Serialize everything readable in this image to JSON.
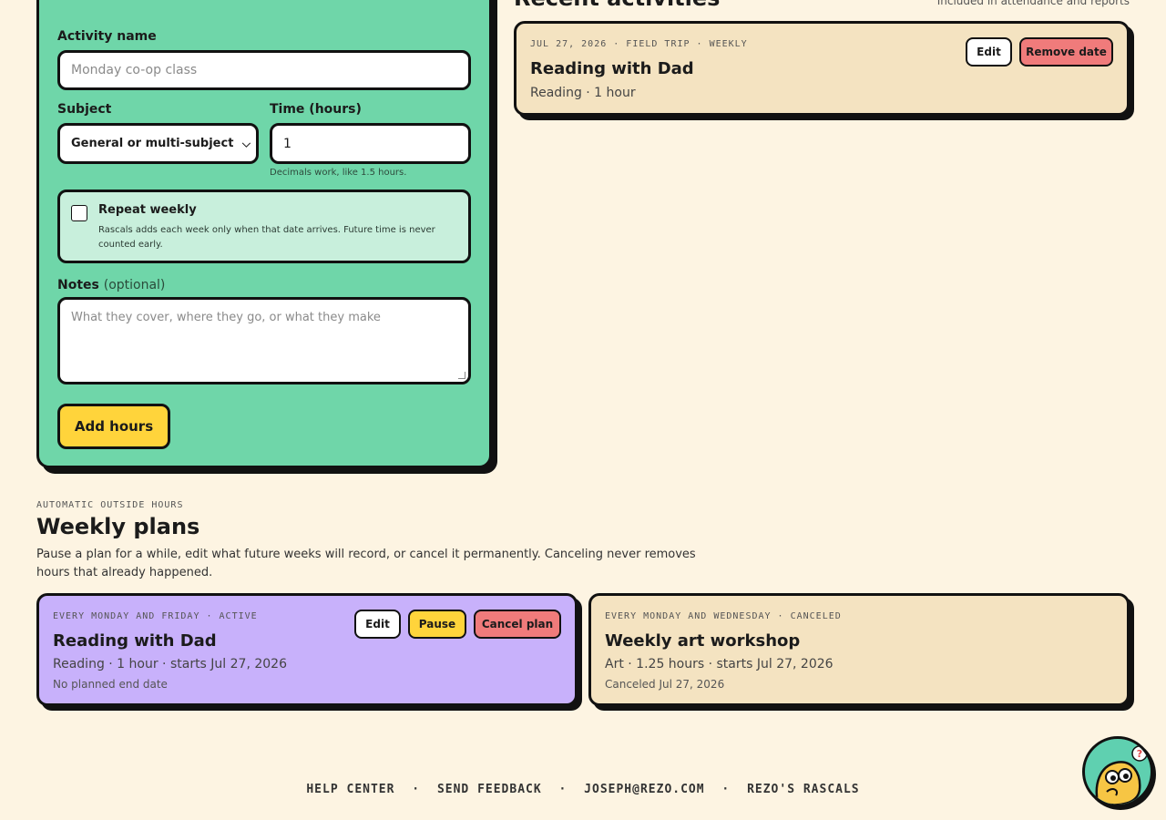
{
  "form": {
    "activity_name_label": "Activity name",
    "activity_name_placeholder": "Monday co-op class",
    "subject_label": "Subject",
    "subject_value": "General or multi-subject",
    "time_label": "Time (hours)",
    "time_value": "1",
    "time_hint": "Decimals work, like 1.5 hours.",
    "repeat_title": "Repeat weekly",
    "repeat_desc": "Rascals adds each week only when that date arrives. Future time is never counted early.",
    "notes_label": "Notes",
    "notes_optional": "(optional)",
    "notes_placeholder": "What they cover, where they go, or what they make",
    "submit_label": "Add hours"
  },
  "recent": {
    "title": "Recent activities",
    "note": "Included in attendance and reports",
    "items": [
      {
        "meta": "JUL 27, 2026 · FIELD TRIP · WEEKLY",
        "title": "Reading with Dad",
        "subtitle": "Reading · 1 hour",
        "edit_label": "Edit",
        "remove_label": "Remove date"
      }
    ]
  },
  "weekly": {
    "kicker": "AUTOMATIC OUTSIDE HOURS",
    "title": "Weekly plans",
    "description": "Pause a plan for a while, edit what future weeks will record, or cancel it permanently. Canceling never removes hours that already happened.",
    "plans": [
      {
        "meta": "EVERY MONDAY AND FRIDAY · ACTIVE",
        "title": "Reading with Dad",
        "subtitle": "Reading · 1 hour · starts Jul 27, 2026",
        "detail": "No planned end date",
        "edit_label": "Edit",
        "pause_label": "Pause",
        "cancel_label": "Cancel plan"
      },
      {
        "meta": "EVERY MONDAY AND WEDNESDAY · CANCELED",
        "title": "Weekly art workshop",
        "subtitle": "Art · 1.25 hours · starts Jul 27, 2026",
        "detail": "Canceled Jul 27, 2026"
      }
    ]
  },
  "footer": {
    "help": "HELP CENTER",
    "feedback": "SEND FEEDBACK",
    "email": "JOSEPH@REZO.COM",
    "brand": "REZO'S RASCALS",
    "separator": "·"
  },
  "icons": {
    "mascot": "mascot-help-icon",
    "select_caret": "chevron-down-icon"
  },
  "colors": {
    "page_bg": "#fdf4e2",
    "form_bg": "#6fd6a9",
    "card_bg": "#f4e3c1",
    "active_plan_bg": "#c8b1fb",
    "primary_yellow": "#ffd43b",
    "danger_red": "#f07b7b"
  }
}
